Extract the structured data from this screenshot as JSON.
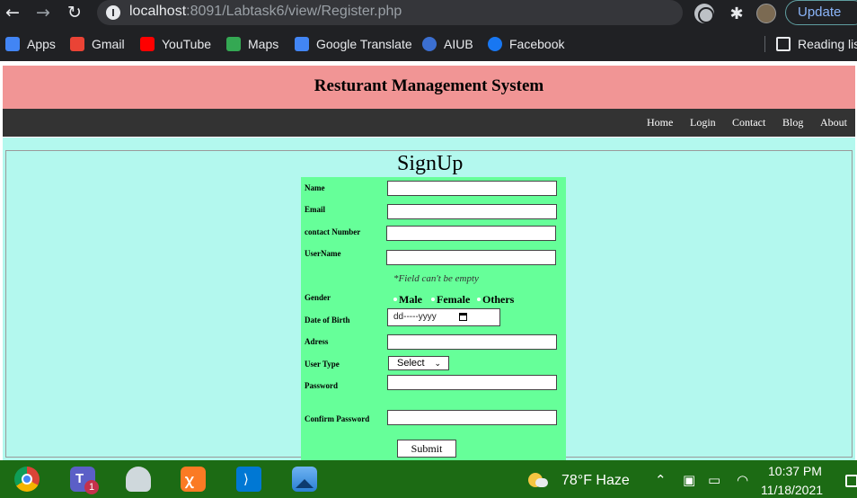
{
  "browser": {
    "url_host": "localhost",
    "url_rest": ":8091/Labtask6/view/Register.php",
    "update_label": "Update",
    "bookmarks": [
      {
        "label": "Apps",
        "icon": "apps-grid-icon",
        "color": "#4285f4"
      },
      {
        "label": "Gmail",
        "icon": "gmail-icon",
        "color": "#ea4335"
      },
      {
        "label": "YouTube",
        "icon": "youtube-icon",
        "color": "#ff0000"
      },
      {
        "label": "Maps",
        "icon": "maps-icon",
        "color": "#34a853"
      },
      {
        "label": "Google Translate",
        "icon": "translate-icon",
        "color": "#4285f4"
      },
      {
        "label": "AIUB",
        "icon": "aiub-icon",
        "color": "#3b6fd1"
      },
      {
        "label": "Facebook",
        "icon": "facebook-icon",
        "color": "#1877f2"
      }
    ],
    "reading_list_label": "Reading list"
  },
  "site": {
    "title": "Resturant Management System",
    "nav": [
      "Home",
      "Login",
      "Contact",
      "Blog",
      "About"
    ],
    "header_color": "#f19595",
    "navbar_color": "#333333",
    "background_color": "#b3f8ee"
  },
  "form": {
    "legend": "SignUp",
    "panel_color": "#66ff99",
    "labels": {
      "name": "Name",
      "email": "Email",
      "contact": "contact Number",
      "username": "UserName",
      "gender": "Gender",
      "dob": "Date of Birth",
      "address": "Adress",
      "user_type": "User Type",
      "password": "Password",
      "confirm_password": "Confirm Password"
    },
    "hint": "*Field can't be empty",
    "gender_options": [
      "Male",
      "Female",
      "Others"
    ],
    "dob_placeholder": "dd-----yyyy",
    "user_type_selected": "Select",
    "submit_label": "Submit"
  },
  "taskbar": {
    "weather": "78°F  Haze",
    "time": "10:37 PM",
    "date": "11/18/2021",
    "teams_badge": "1",
    "apps": [
      {
        "name": "chrome",
        "color": "#db4437"
      },
      {
        "name": "teams",
        "color": "#5b5fc7"
      },
      {
        "name": "snipping-tool",
        "color": "#cfd8dc"
      },
      {
        "name": "xampp",
        "color": "#fb7a24"
      },
      {
        "name": "vscode",
        "color": "#0078d4"
      },
      {
        "name": "photos",
        "color": "#2a7fd4"
      }
    ]
  }
}
